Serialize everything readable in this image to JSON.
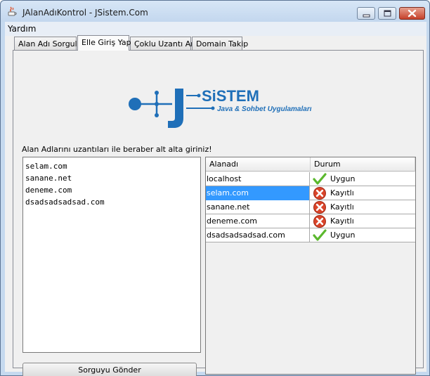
{
  "window": {
    "title": "JAlanAdıKontrol - JSistem.Com",
    "buttons": [
      "minimize",
      "maximize",
      "close"
    ]
  },
  "menubar": {
    "items": [
      "Yardım"
    ]
  },
  "tabs": [
    {
      "label": "Alan Adı Sorgula",
      "active": false
    },
    {
      "label": "Elle Giriş Yap",
      "active": true
    },
    {
      "label": "Çoklu Uzantı Ara",
      "active": false
    },
    {
      "label": "Domain Takip",
      "active": false
    }
  ],
  "logo": {
    "brand": "SiSTEM",
    "tagline": "Java & Sohbet Uygulamaları"
  },
  "form": {
    "instruction": "Alan Adlarını uzantıları ile beraber alt alta giriniz!",
    "textarea_value": "selam.com\nsanane.net\ndeneme.com\ndsadsadsadsad.com",
    "submit_label": "Sorguyu Gönder"
  },
  "results": {
    "columns": [
      "Alanadı",
      "Durum"
    ],
    "rows": [
      {
        "domain": "localhost",
        "status": "Uygun",
        "icon": "check-icon",
        "selected": false
      },
      {
        "domain": "selam.com",
        "status": "Kayıtlı",
        "icon": "error-icon",
        "selected": true
      },
      {
        "domain": "sanane.net",
        "status": "Kayıtlı",
        "icon": "error-icon",
        "selected": false
      },
      {
        "domain": "deneme.com",
        "status": "Kayıtlı",
        "icon": "error-icon",
        "selected": false
      },
      {
        "domain": "dsadsadsadsad.com",
        "status": "Uygun",
        "icon": "check-icon",
        "selected": false
      }
    ]
  },
  "colors": {
    "logo_blue": "#1f6fb8",
    "selection": "#3399ff",
    "ok_green": "#5bb82e",
    "error_red": "#d9442a"
  }
}
